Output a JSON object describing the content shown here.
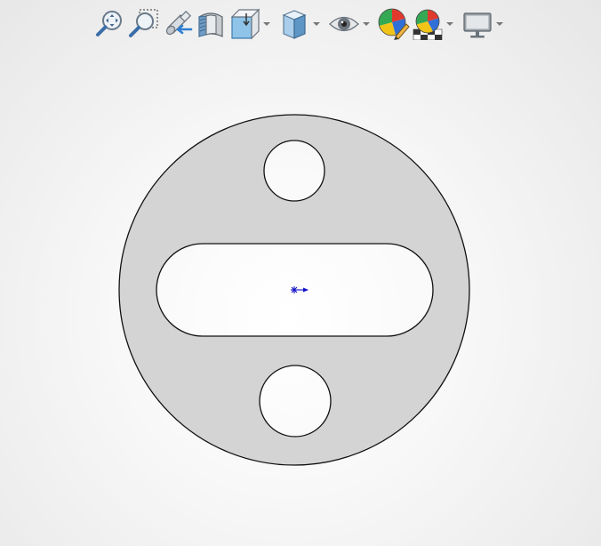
{
  "toolbar": {
    "buttons": [
      {
        "name": "zoom-to-fit",
        "icon": "zoom-to-fit-icon",
        "has_dropdown": false
      },
      {
        "name": "zoom-to-area",
        "icon": "zoom-to-area-icon",
        "has_dropdown": false
      },
      {
        "name": "previous-view",
        "icon": "previous-view-icon",
        "has_dropdown": false
      },
      {
        "name": "section-view",
        "icon": "section-view-icon",
        "has_dropdown": false
      },
      {
        "name": "view-orientation",
        "icon": "view-orientation-icon",
        "has_dropdown": true
      },
      {
        "name": "display-style",
        "icon": "display-style-icon",
        "has_dropdown": true
      },
      {
        "name": "hide-show-items",
        "icon": "eye-icon",
        "has_dropdown": true
      },
      {
        "name": "edit-appearance",
        "icon": "appearance-icon",
        "has_dropdown": false
      },
      {
        "name": "apply-scene",
        "icon": "scene-icon",
        "has_dropdown": true
      },
      {
        "name": "view-settings",
        "icon": "monitor-icon",
        "has_dropdown": true
      }
    ]
  },
  "model": {
    "part_fill": "#d4d4d4",
    "edge_color": "#111111",
    "origin_color": "#1010c8"
  }
}
